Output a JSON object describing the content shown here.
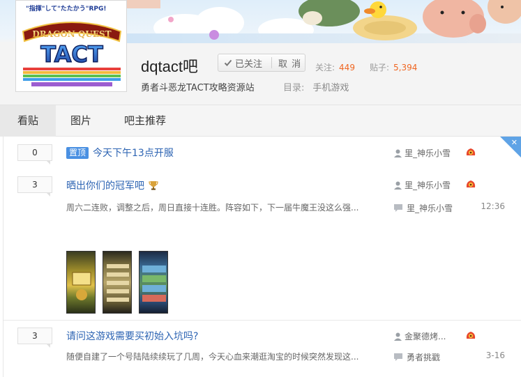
{
  "header": {
    "logo_tagline": "\"指揮\"して\"たたかう\"RPG!",
    "logo_top_text": "DRAGON QUEST",
    "logo_main_text": "TACT",
    "forum_name": "dqtact吧",
    "follow_button": {
      "followed_label": "已关注",
      "cancel_label": "取 消"
    },
    "stats": {
      "follow_label": "关注:",
      "follow_count": "449",
      "posts_label": "贴子:",
      "posts_count": "5,394"
    },
    "slogan": "勇者斗恶龙TACT攻略资源站",
    "catalog_label": "目录:",
    "catalog_value": "手机游戏"
  },
  "tabs": [
    {
      "label": "看贴",
      "active": true
    },
    {
      "label": "图片",
      "active": false
    },
    {
      "label": "吧主推荐",
      "active": false
    }
  ],
  "threads": [
    {
      "reply_count": "0",
      "top_badge": "置顶",
      "title": "今天下午13点开服",
      "author": "里_神乐小雪",
      "author_badge_icon": "game-badge-icon"
    },
    {
      "reply_count": "3",
      "title": "晒出你们的冠军吧",
      "title_icon": "trophy-icon",
      "author": "里_神乐小雪",
      "author_badge_icon": "game-badge-icon",
      "abstract": "周六二连败，调整之后，周日直接十连胜。阵容如下，下一届牛魔王没这么强...",
      "last_reply_user": "里_神乐小雪",
      "last_reply_time": "12:36",
      "images": [
        "screenshot-1",
        "screenshot-2",
        "screenshot-3"
      ]
    },
    {
      "reply_count": "3",
      "title": "请问这游戏需要买初始入坑吗?",
      "author": "金聚德烤...",
      "author_badge_icon": "game-badge-icon",
      "abstract": "随便自建了一个号陆陆续续玩了几周，今天心血来潮逛淘宝的时候突然发现这...",
      "last_reply_user": "勇者挑戳",
      "last_reply_time": "3-16"
    }
  ],
  "colors": {
    "link_blue": "#2d64b3",
    "count_orange": "#f06621",
    "top_badge_blue": "#4a90e2",
    "tab_active_bg": "#e8e8e8"
  }
}
